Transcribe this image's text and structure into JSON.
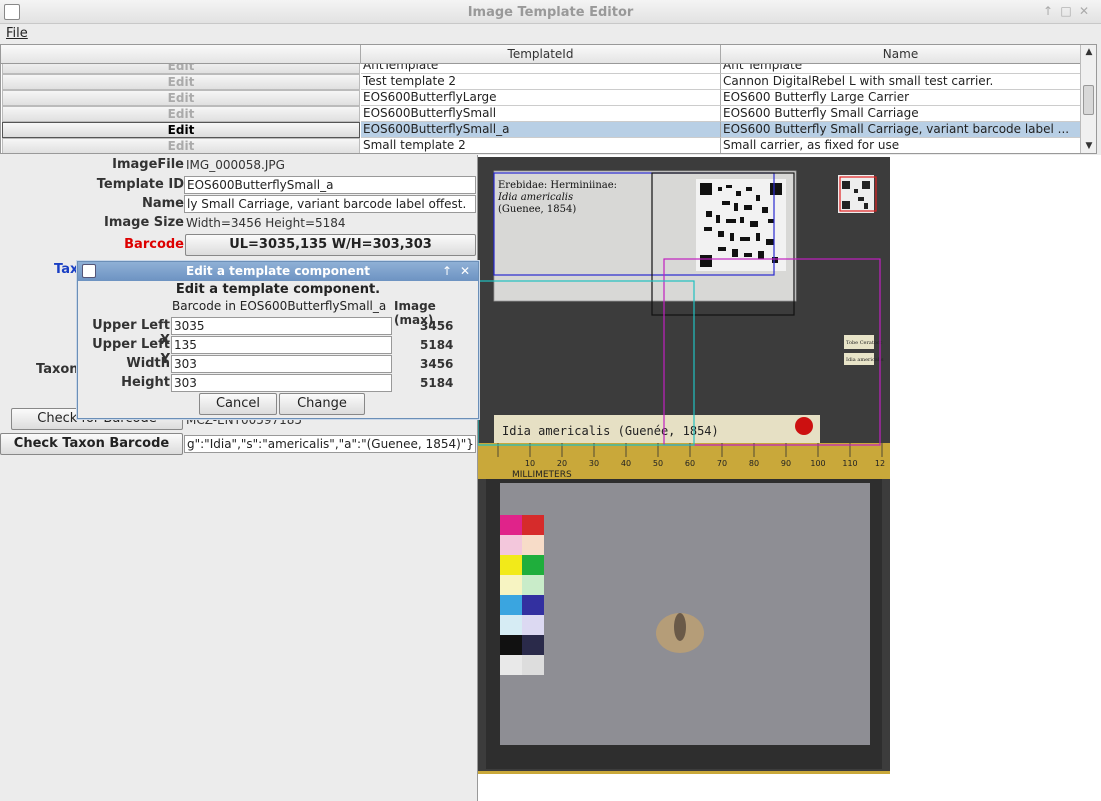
{
  "window": {
    "title": "Image Template Editor"
  },
  "menu": {
    "file": "File"
  },
  "table": {
    "headers": [
      "",
      "TemplateId",
      "Name"
    ],
    "rows": [
      {
        "edit": "Edit",
        "id": "AntTemplate",
        "name": "Ant Template",
        "selected": false
      },
      {
        "edit": "Edit",
        "id": "Test template 2",
        "name": "Cannon DigitalRebel L with small test carrier.",
        "selected": false
      },
      {
        "edit": "Edit",
        "id": "EOS600ButterflyLarge",
        "name": "EOS600 Butterfly Large Carrier",
        "selected": false
      },
      {
        "edit": "Edit",
        "id": "EOS600ButterflySmall",
        "name": "EOS600 Butterfly Small Carriage",
        "selected": false
      },
      {
        "edit": "Edit",
        "id": "EOS600ButterflySmall_a",
        "name": "EOS600 Butterfly Small Carriage, variant barcode label ...",
        "selected": true
      },
      {
        "edit": "Edit",
        "id": "Small template 2",
        "name": "Small carrier, as fixed for use",
        "selected": false
      }
    ]
  },
  "form": {
    "image_file_label": "ImageFile",
    "image_file": "IMG_000058.JPG",
    "template_id_label": "Template ID",
    "template_id": "EOS600ButterflySmall_a",
    "name_label": "Name",
    "name": "ly Small Carriage, variant barcode label offest.",
    "image_size_label": "Image Size",
    "image_size": "Width=3456 Height=5184",
    "barcode_label": "Barcode",
    "barcode_value": "UL=3035,135 W/H=303,303",
    "taxon_partial": "Tax",
    "taxon_label_partial": "Taxon",
    "check_barcode": "Check for Barcode",
    "barcode_result": "MCZ-ENT00597185",
    "check_taxon": "Check Taxon Barcode",
    "taxon_result": "g\":\"Idia\",\"s\":\"americalis\",\"a\":\"(Guenee, 1854)\"}"
  },
  "dialog": {
    "title": "Edit a template component",
    "heading": "Edit a template component.",
    "component": "Barcode in EOS600ButterflySmall_a",
    "max_header": "Image (max)",
    "fields": [
      {
        "label": "Upper Left X",
        "value": "3035",
        "max": "3456"
      },
      {
        "label": "Upper Left Y",
        "value": "135",
        "max": "5184"
      },
      {
        "label": "Width",
        "value": "303",
        "max": "3456"
      },
      {
        "label": "Height",
        "value": "303",
        "max": "5184"
      }
    ],
    "cancel": "Cancel",
    "change": "Change"
  },
  "photo": {
    "label_line1": "Erebidae: Herminiinae:",
    "label_line2": "Idia americalis",
    "label_line3": "(Guenee, 1854)",
    "species_strip": "Idia americalis (Guenée, 1854)",
    "ruler_caption": "MILLIMETERS",
    "ruler_numbers": [
      "10",
      "20",
      "30",
      "40",
      "50",
      "60",
      "70",
      "80",
      "90",
      "100",
      "110",
      "12"
    ],
    "small_label_1": "Tobe Ceratocc",
    "small_label_2": "Idia americalis"
  }
}
